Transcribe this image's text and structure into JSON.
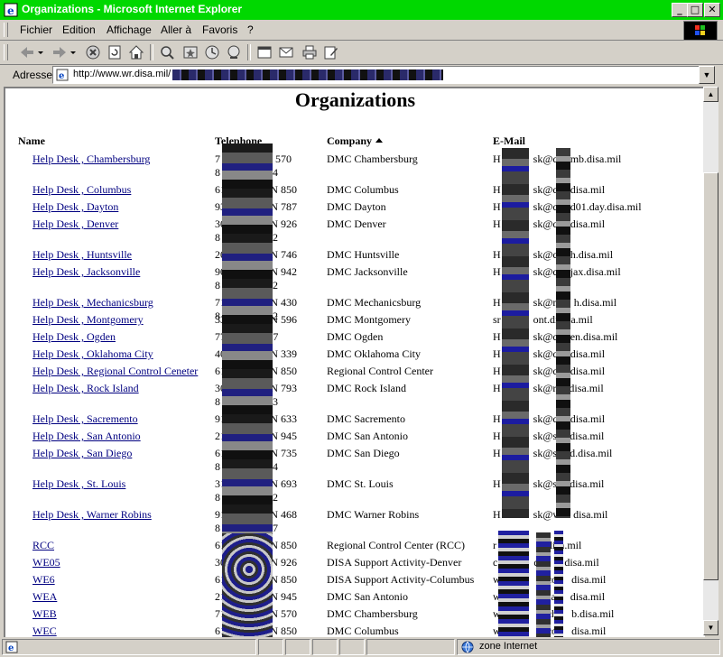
{
  "window": {
    "title": "Organizations - Microsoft Internet Explorer",
    "title_color": "#00d800"
  },
  "window_buttons": [
    "_",
    "□",
    "✕"
  ],
  "menu": [
    "Fichier",
    "Edition",
    "Affichage",
    "Aller à",
    "Favoris",
    "?"
  ],
  "toolbar_icons": [
    "back-icon",
    "forward-icon",
    "stop-icon",
    "refresh-icon",
    "home-icon",
    "search-icon",
    "favorites-icon",
    "history-icon",
    "channels-icon",
    "fullscreen-icon",
    "mail-icon",
    "print-icon",
    "edit-icon"
  ],
  "address": {
    "label": "Adresse",
    "url": "http://www.wr.disa.mil/"
  },
  "page": {
    "title": "Organizations",
    "link_color": "#000080"
  },
  "table": {
    "headers": {
      "name": "Name",
      "telephone": "Telephone",
      "company": "Company",
      "email": "E-Mail"
    },
    "rows": [
      {
        "name": "Help Desk , Chambersburg",
        "tel": "0, DSN 570",
        "tel_line2": "4",
        "company": "DMC Chambersburg",
        "email_pre": "H",
        "email": "sk@c",
        "email_post": "mb.disa.mil"
      },
      {
        "name": "Help Desk , Columbus",
        "tel": "0, DSN 850",
        "tel_line2": "",
        "company": "DMC Columbus",
        "email_pre": "H",
        "email": "sk@c",
        "email_post": "disa.mil"
      },
      {
        "name": "Help Desk , Dayton",
        "tel": "1, DSN 787",
        "tel_line2": "",
        "company": "DMC Dayton",
        "email_pre": "H",
        "email": "sk@c",
        "email_post": "d01.day.disa.mil"
      },
      {
        "name": "Help Desk , Denver",
        "tel": "5, DSN 926",
        "tel_line2": "2",
        "company": "DMC Denver",
        "email_pre": "H",
        "email": "sk@c",
        "email_post": "disa.mil"
      },
      {
        "name": "Help Desk , Huntsville",
        "tel": "0, DSN 746",
        "tel_line2": "",
        "company": "DMC Huntsville",
        "email_pre": "H",
        "email": "sk@c",
        "email_post": "h.disa.mil"
      },
      {
        "name": "Help Desk , Jacksonville",
        "tel": "0, DSN 942",
        "tel_line2": "2",
        "company": "DMC Jacksonville",
        "email_pre": "H",
        "email": "sk@c",
        "email_post": "jax.disa.mil"
      },
      {
        "name": "Help Desk , Mechanicsburg",
        "tel": "5, DSN 430",
        "tel_line2": "2",
        "company": "DMC Mechanicsburg",
        "email_pre": "H",
        "email": "sk@m",
        "email_post": "h.disa.mil"
      },
      {
        "name": "Help Desk , Montgomery",
        "tel": "5, DSN 596",
        "tel_line2": "",
        "company": "DMC Montgomery",
        "email_pre": "sr",
        "email": "ont.di",
        "email_post": "a.mil"
      },
      {
        "name": "Help Desk , Ogden",
        "tel": "SN 777",
        "tel_line2": "",
        "company": "DMC Ogden",
        "email_pre": "H",
        "email": "sk@c",
        "email_post": "en.disa.mil"
      },
      {
        "name": "Help Desk , Oklahoma City",
        "tel": "0, DSN 339",
        "tel_line2": "",
        "company": "DMC Oklahoma City",
        "email_pre": "H",
        "email": "sk@c",
        "email_post": "disa.mil"
      },
      {
        "name": "Help Desk , Regional Control Ceneter",
        "tel": "0, DSN 850",
        "tel_line2": "",
        "company": "Regional Control Center",
        "email_pre": "H",
        "email": "sk@c",
        "email_post": "disa.mil"
      },
      {
        "name": "Help Desk , Rock Island",
        "tel": "0, DSN 793",
        "tel_line2": "3",
        "company": "DMC Rock Island",
        "email_pre": "H",
        "email": "sk@r",
        "email_post": "disa.mil"
      },
      {
        "name": "Help Desk , Sacremento",
        "tel": "1, DSN 633",
        "tel_line2": "",
        "company": "DMC Sacremento",
        "email_pre": "H",
        "email": "sk@c",
        "email_post": "disa.mil"
      },
      {
        "name": "Help Desk , San Antonio",
        "tel": "3, DSN 945",
        "tel_line2": "",
        "company": "DMC San Antonio",
        "email_pre": "H",
        "email": "sk@s",
        "email_post": "disa.mil"
      },
      {
        "name": "Help Desk , San Diego",
        "tel": "5, DSN 735",
        "tel_line2": "4",
        "company": "DMC San Diego",
        "email_pre": "H",
        "email": "sk@s",
        "email_post": "d.disa.mil"
      },
      {
        "name": "Help Desk , St. Louis",
        "tel": "7, DSN 693",
        "tel_line2": "2",
        "company": "DMC St. Louis",
        "email_pre": "H",
        "email": "sk@s",
        "email_post": "disa.mil"
      },
      {
        "name": "Help Desk , Warner Robins",
        "tel": "0, DSN 468",
        "tel_line2": "7",
        "company": "DMC Warner Robins",
        "email_pre": "H",
        "email": "sk@w",
        "email_post": "disa.mil"
      },
      {
        "name": "RCC",
        "tel": "0, DSN 850",
        "tel_line2": "",
        "company": "Regional Control Center (RCC)",
        "email_pre": "r",
        "email": "",
        "email_post": "disa.mil"
      },
      {
        "name": "WE05",
        "tel": "3, DSN 926",
        "tel_line2": "",
        "company": "DISA Support Activity-Denver",
        "email_pre": "c",
        "email": "dnv",
        "email_post": "disa.mil"
      },
      {
        "name": "WE6",
        "tel": "3, DSN 850",
        "tel_line2": "",
        "company": "DISA Support Activity-Columbus",
        "email_pre": "w",
        "email": "@co",
        "email_post": "disa.mil"
      },
      {
        "name": "WEA",
        "tel": "8, DSN 945",
        "tel_line2": "",
        "company": "DMC San Antonio",
        "email_pre": "w",
        "email": "@sa",
        "email_post": "disa.mil"
      },
      {
        "name": "WEB",
        "tel": "3, DSN 570",
        "tel_line2": "",
        "company": "DMC Chambersburg",
        "email_pre": "w",
        "email": "@ch",
        "email_post": "b.disa.mil"
      },
      {
        "name": "WEC",
        "tel": "8, DSN 850",
        "tel_line2": "",
        "company": "DMC Columbus",
        "email_pre": "w",
        "email": "@co",
        "email_post": "disa.mil"
      }
    ]
  },
  "tel_prefixes": [
    "7",
    "61",
    "93",
    "30",
    "20",
    "90",
    "71",
    "33",
    "77",
    "40",
    "61",
    "30",
    "91",
    "21",
    "61",
    "31",
    "91",
    "61",
    "30",
    "61",
    "21",
    "71",
    "61"
  ],
  "tel_line2_prefix": "8",
  "status": {
    "zone": "zone Internet"
  }
}
